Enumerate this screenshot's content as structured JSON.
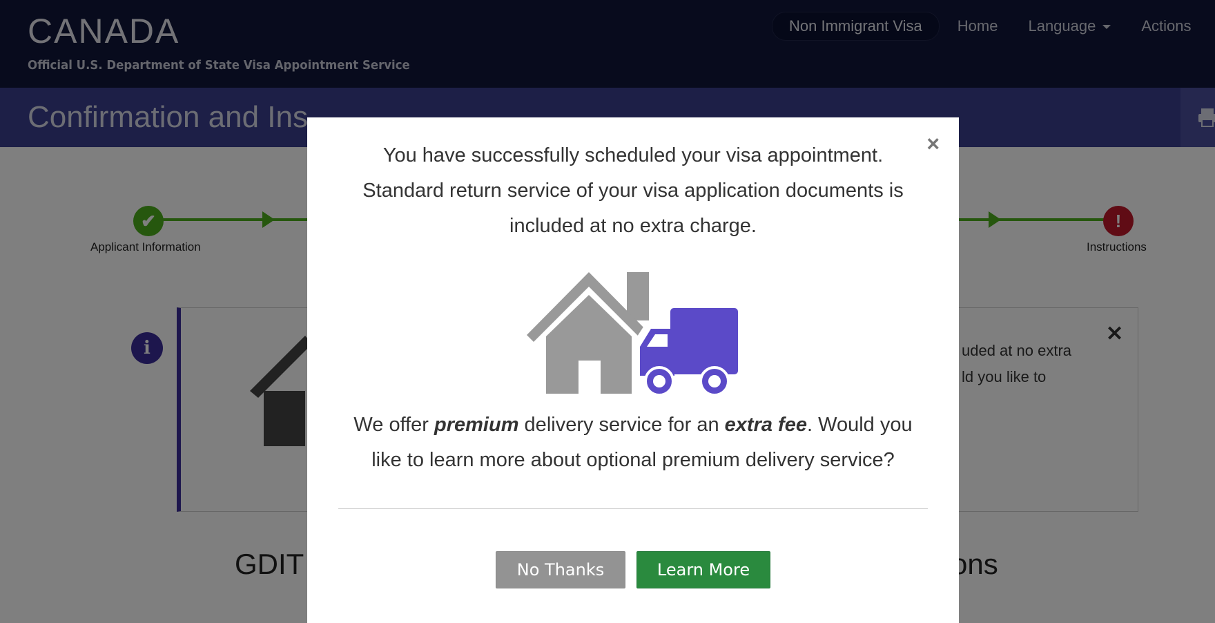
{
  "header": {
    "brand_title": "CANADA",
    "brand_subtitle": "Official U.S. Department of State Visa Appointment Service",
    "nav": {
      "visa_type": "Non Immigrant Visa",
      "home": "Home",
      "language": "Language",
      "actions": "Actions"
    }
  },
  "page": {
    "title_fragment": "Confirmation and Ins"
  },
  "progress": {
    "first_step_label": "Applicant Information",
    "last_step_label": "Instructions",
    "first_step_icon": "check-icon",
    "last_step_icon": "exclamation-icon",
    "complete_color": "#4caf1c",
    "alert_color": "#c0182b"
  },
  "background_card": {
    "text_line1": "uded at no extra",
    "text_line2": "ld you like to",
    "heading_left": "GDIT",
    "heading_right": "ons"
  },
  "modal": {
    "message_line1": "You have successfully scheduled your visa appointment.",
    "message_line2": "Standard return service of your visa application documents is",
    "message_line3": "included at no extra charge.",
    "offer_pre": "We offer ",
    "offer_premium": "premium",
    "offer_mid": " delivery service for an ",
    "offer_fee": "extra fee",
    "offer_post": ". Would you",
    "offer_line2": "like to learn more about optional premium delivery service?",
    "close_symbol": "×",
    "no_thanks_label": "No Thanks",
    "learn_more_label": "Learn More",
    "illustration": [
      "house-icon",
      "delivery-truck-icon"
    ],
    "truck_color": "#5b4ac8",
    "house_color": "#999999"
  }
}
